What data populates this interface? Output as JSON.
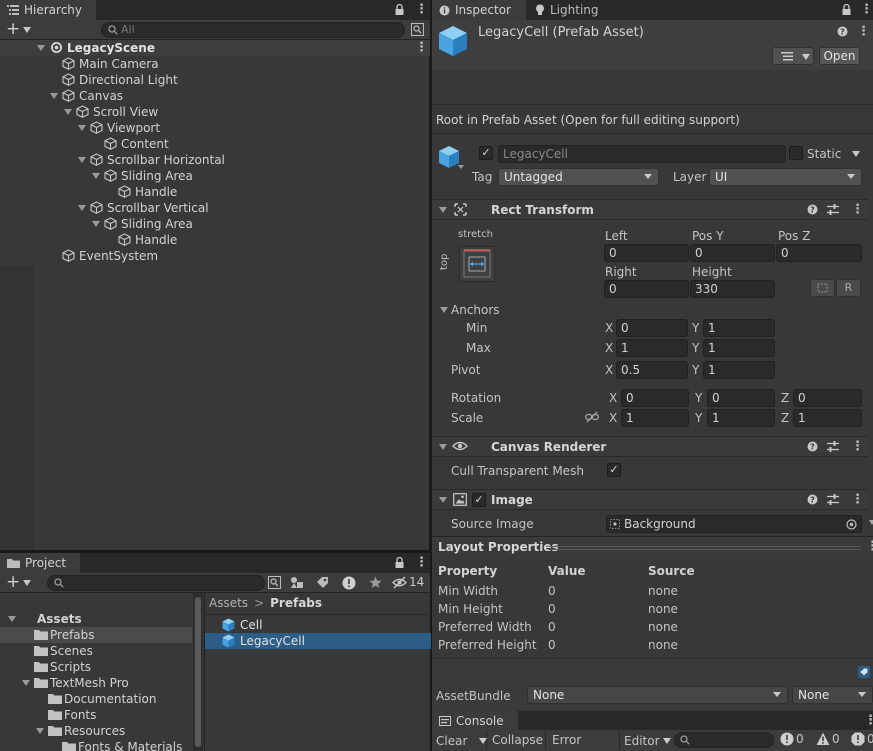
{
  "hierarchy": {
    "tab_label": "Hierarchy",
    "search_placeholder": "All",
    "add_label": "+",
    "scene_name": "LegacyScene",
    "items": [
      {
        "label": "Main Camera",
        "depth": 1,
        "fold": "none",
        "icon": "gameobject-icon"
      },
      {
        "label": "Directional Light",
        "depth": 1,
        "fold": "none",
        "icon": "gameobject-icon"
      },
      {
        "label": "Canvas",
        "depth": 1,
        "fold": "open",
        "icon": "gameobject-icon"
      },
      {
        "label": "Scroll View",
        "depth": 2,
        "fold": "open",
        "icon": "gameobject-icon"
      },
      {
        "label": "Viewport",
        "depth": 3,
        "fold": "open",
        "icon": "gameobject-icon"
      },
      {
        "label": "Content",
        "depth": 4,
        "fold": "none",
        "icon": "gameobject-icon"
      },
      {
        "label": "Scrollbar Horizontal",
        "depth": 3,
        "fold": "open",
        "icon": "gameobject-icon"
      },
      {
        "label": "Sliding Area",
        "depth": 4,
        "fold": "open",
        "icon": "gameobject-icon"
      },
      {
        "label": "Handle",
        "depth": 5,
        "fold": "none",
        "icon": "gameobject-icon"
      },
      {
        "label": "Scrollbar Vertical",
        "depth": 3,
        "fold": "open",
        "icon": "gameobject-icon"
      },
      {
        "label": "Sliding Area",
        "depth": 4,
        "fold": "open",
        "icon": "gameobject-icon"
      },
      {
        "label": "Handle",
        "depth": 5,
        "fold": "none",
        "icon": "gameobject-icon"
      },
      {
        "label": "EventSystem",
        "depth": 1,
        "fold": "none",
        "icon": "gameobject-icon"
      }
    ]
  },
  "project": {
    "tab_label": "Project",
    "add_label": "+",
    "hidden_count": "14",
    "tree": [
      {
        "label": "Assets",
        "depth": 0,
        "fold": "open",
        "bold": true
      },
      {
        "label": "Prefabs",
        "depth": 1,
        "fold": "none",
        "selected": true
      },
      {
        "label": "Scenes",
        "depth": 1,
        "fold": "none"
      },
      {
        "label": "Scripts",
        "depth": 1,
        "fold": "none"
      },
      {
        "label": "TextMesh Pro",
        "depth": 1,
        "fold": "open"
      },
      {
        "label": "Documentation",
        "depth": 2,
        "fold": "none"
      },
      {
        "label": "Fonts",
        "depth": 2,
        "fold": "none"
      },
      {
        "label": "Resources",
        "depth": 2,
        "fold": "open"
      },
      {
        "label": "Fonts & Materials",
        "depth": 3,
        "fold": "none"
      }
    ],
    "breadcrumb": {
      "root": "Assets",
      "sep": ">",
      "current": "Prefabs"
    },
    "files": [
      {
        "label": "Cell",
        "selected": false
      },
      {
        "label": "LegacyCell",
        "selected": true
      }
    ]
  },
  "inspector": {
    "tabs": [
      {
        "label": "Inspector",
        "icon": "info-icon"
      },
      {
        "label": "Lighting",
        "icon": "bulb-icon"
      }
    ],
    "asset_title": "LegacyCell (Prefab Asset)",
    "open_label": "Open",
    "root_notice": "Root in Prefab Asset (Open for full editing support)",
    "object_name": "LegacyCell",
    "static_label": "Static",
    "tag_label": "Tag",
    "tag_value": "Untagged",
    "layer_label": "Layer",
    "layer_value": "UI",
    "rect_transform": {
      "title": "Rect Transform",
      "anchor_preset_top": "stretch",
      "anchor_preset_side": "top",
      "col_left": "Left",
      "col_posy": "Pos Y",
      "col_posz": "Pos Z",
      "left": "0",
      "posy": "0",
      "posz": "0",
      "col_right": "Right",
      "col_height": "Height",
      "right": "0",
      "height": "330",
      "r_button": "R",
      "anchors_label": "Anchors",
      "min_label": "Min",
      "max_label": "Max",
      "min_x": "0",
      "min_y": "1",
      "max_x": "1",
      "max_y": "1",
      "pivot_label": "Pivot",
      "pivot_x": "0.5",
      "pivot_y": "1",
      "rotation_label": "Rotation",
      "rot_x": "0",
      "rot_y": "0",
      "rot_z": "0",
      "scale_label": "Scale",
      "scale_x": "1",
      "scale_y": "1",
      "scale_z": "1",
      "axis_x": "X",
      "axis_y": "Y",
      "axis_z": "Z"
    },
    "canvas_renderer": {
      "title": "Canvas Renderer",
      "cull_label": "Cull Transparent Mesh"
    },
    "image": {
      "title": "Image",
      "source_label": "Source Image",
      "source_value": "Background"
    },
    "layout_properties": {
      "title": "Layout Properties",
      "headers": [
        "Property",
        "Value",
        "Source"
      ],
      "rows": [
        [
          "Min Width",
          "0",
          "none"
        ],
        [
          "Min Height",
          "0",
          "none"
        ],
        [
          "Preferred Width",
          "0",
          "none"
        ],
        [
          "Preferred Height",
          "0",
          "none"
        ]
      ]
    },
    "assetbundle": {
      "label": "AssetBundle",
      "name_value": "None",
      "variant_value": "None"
    }
  },
  "console": {
    "tab_label": "Console",
    "clear_label": "Clear",
    "collapse_label": "Collapse",
    "error_pause_label": "Error Pause",
    "editor_label": "Editor",
    "info_count": "0",
    "warn_count": "0",
    "error_count": "0"
  },
  "colors": {
    "selection": "#2c5d87",
    "accent_blue": "#4aa3df",
    "panel": "#383838"
  }
}
